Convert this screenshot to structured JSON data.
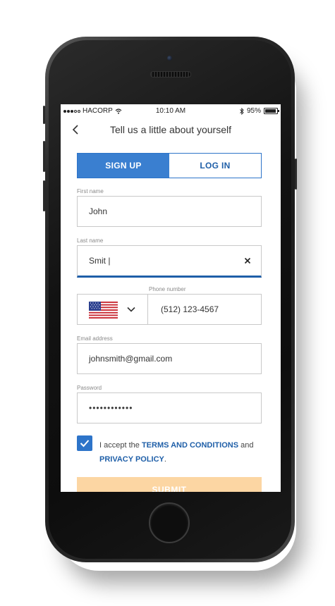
{
  "status_bar": {
    "carrier": "HACORP",
    "time": "10:10 AM",
    "battery_percent": "95%",
    "battery_level": 0.95,
    "icons": [
      "signal-icon",
      "wifi-icon",
      "bluetooth-icon",
      "battery-icon"
    ]
  },
  "header": {
    "title": "Tell us a little about yourself",
    "back_icon": "chevron-left-icon"
  },
  "tabs": [
    {
      "label": "SIGN UP",
      "active": true
    },
    {
      "label": "LOG IN",
      "active": false
    }
  ],
  "form": {
    "first_name": {
      "label": "First name",
      "value": "John"
    },
    "last_name": {
      "label": "Last name",
      "value": "Smit |",
      "focused": true
    },
    "phone": {
      "label": "Phone number",
      "country_icon": "us-flag-icon",
      "value": "(512) 123-4567"
    },
    "email": {
      "label": "Email address",
      "value": "johnsmith@gmail.com"
    },
    "password": {
      "label": "Password",
      "value": "••••••••••••"
    }
  },
  "terms": {
    "checked": true,
    "prefix": "I accept the",
    "terms_link": "TERMS AND CONDITIONS",
    "middle": "and",
    "privacy_link": "PRIVACY POLICY",
    "suffix": "."
  },
  "submit_label": "SUBMIT",
  "colors": {
    "primary": "#3a7fd0",
    "link": "#1f5fa8",
    "submit_disabled": "#fcd6a3"
  }
}
